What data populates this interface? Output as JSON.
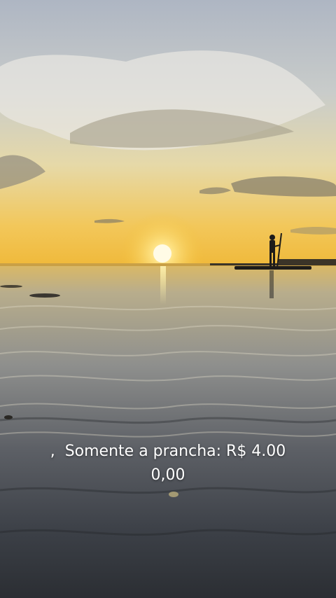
{
  "caption": {
    "lead_mark": ",",
    "line1": "Somente a prancha: R$ 4.00",
    "line2": "0,00"
  },
  "colors": {
    "sky_top": "#b9bfca",
    "sky_mid": "#d8d6c6",
    "horizon_glow": "#f3c13a",
    "sun": "#fff6c2",
    "water_light": "#b9a878",
    "water_dark": "#2f3339",
    "caption_text": "#ffffff"
  }
}
